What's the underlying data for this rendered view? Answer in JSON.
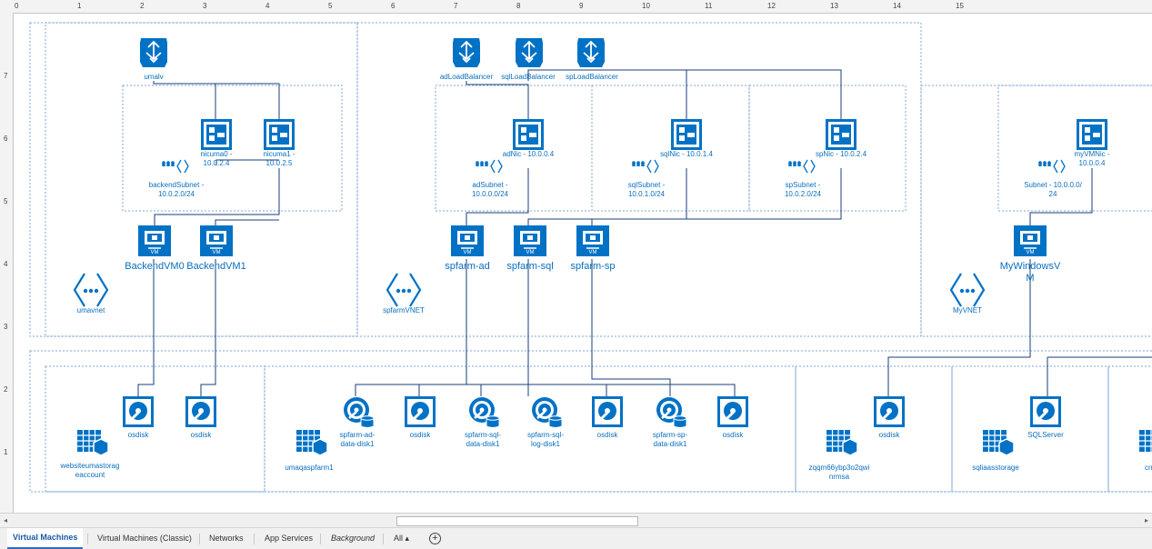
{
  "tabs": [
    {
      "label": "Virtual Machines"
    },
    {
      "label": "Virtual Machines (Classic)"
    },
    {
      "label": "Networks"
    },
    {
      "label": "App Services"
    },
    {
      "label": "Background"
    },
    {
      "label": "All ▴"
    }
  ],
  "rulers": {
    "top": [
      "0",
      "1",
      "2",
      "3",
      "4",
      "5",
      "6",
      "7",
      "8",
      "9",
      "10",
      "11",
      "12",
      "13",
      "14",
      "15"
    ],
    "left": [
      "7",
      "6",
      "5",
      "4",
      "3",
      "2",
      "1"
    ]
  },
  "diagram": {
    "load_balancers": [
      {
        "label": "umalv"
      },
      {
        "label": "adLoadBalancer"
      },
      {
        "label": "sqlLoadBalancer"
      },
      {
        "label": "spLoadBalancer"
      }
    ],
    "nics": [
      {
        "label": "nicuma0 -\n10.0.2.4"
      },
      {
        "label": "nicuma1 -\n10.0.2.5"
      },
      {
        "label": "adNic - 10.0.0.4"
      },
      {
        "label": "sqlNic - 10.0.1.4"
      },
      {
        "label": "spNic - 10.0.2.4"
      },
      {
        "label": "myVMNic -\n10.0.0.4"
      }
    ],
    "subnets": [
      {
        "label": "backendSubnet -\n10.0.2.0/24"
      },
      {
        "label": "adSubnet -\n10.0.0.0/24"
      },
      {
        "label": "sqlSubnet -\n10.0.1.0/24"
      },
      {
        "label": "spSubnet -\n10.0.2.0/24"
      },
      {
        "label": "Subnet - 10.0.0.0/\n24"
      }
    ],
    "vms": [
      {
        "label": "BackendVM0"
      },
      {
        "label": "BackendVM1"
      },
      {
        "label": "spfarm-ad"
      },
      {
        "label": "spfarm-sql"
      },
      {
        "label": "spfarm-sp"
      },
      {
        "label": "MyWindowsV\nM"
      }
    ],
    "vnets": [
      {
        "label": "umavnet"
      },
      {
        "label": "spfarmVNET"
      },
      {
        "label": "MyVNET"
      }
    ],
    "disks": [
      {
        "label": "osdisk"
      },
      {
        "label": "osdisk"
      },
      {
        "label": "spfarm-ad-\ndata-disk1"
      },
      {
        "label": "osdisk"
      },
      {
        "label": "spfarm-sql-\ndata-disk1"
      },
      {
        "label": "spfarm-sql-\nlog-disk1"
      },
      {
        "label": "osdisk"
      },
      {
        "label": "spfarm-sp-\ndata-disk1"
      },
      {
        "label": "osdisk"
      },
      {
        "label": "osdisk"
      },
      {
        "label": "SQLServer"
      }
    ],
    "storage": [
      {
        "label": "websiteumastorag\neaccount"
      },
      {
        "label": "umaqaspfarm1"
      },
      {
        "label": "zqqm66ybp3o2qwi\nnrmsa"
      },
      {
        "label": "sqliaasstorage"
      },
      {
        "label": "crmr"
      }
    ],
    "vm_badge": "VM",
    "icon_names": {
      "load_balancer": "load-balancer-icon",
      "nic": "nic-icon",
      "subnet": "subnet-icon",
      "vm": "vm-icon",
      "vnet": "vnet-icon",
      "disk": "disk-icon",
      "storage": "storage-account-icon"
    },
    "colors": {
      "azure_blue": "#0072c6",
      "label_blue": "#0a6ebd",
      "dotted_border": "#7da7d9",
      "connector": "#1a3f78"
    }
  }
}
